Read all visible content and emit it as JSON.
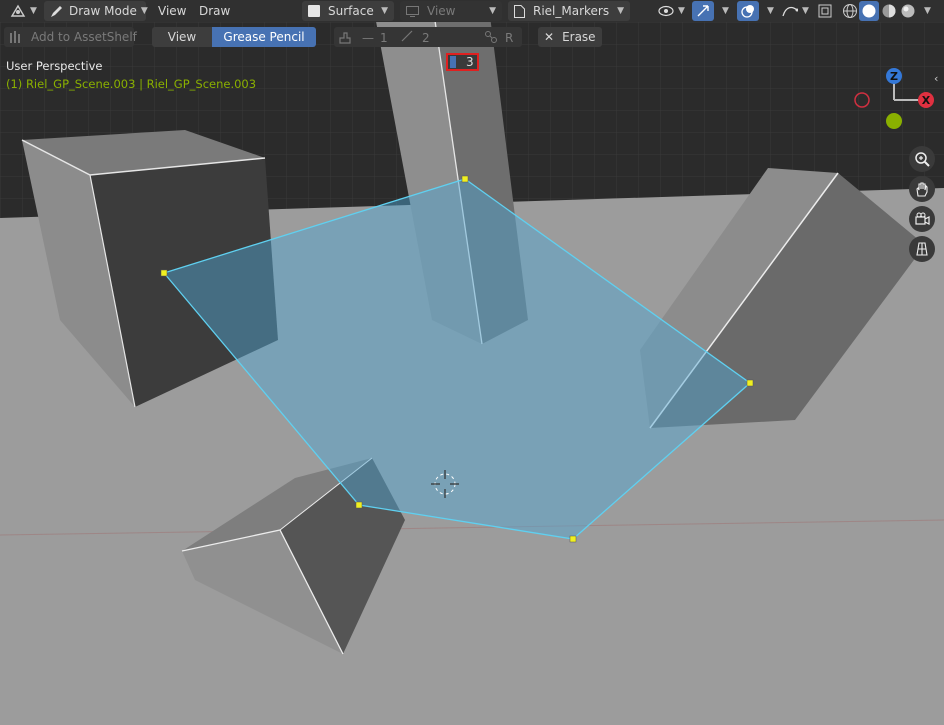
{
  "header": {
    "mode_label": "Draw Mode",
    "menu_view": "View",
    "menu_draw": "Draw",
    "placement_label": "Surface",
    "view_dropdown_label": "View",
    "layer_label": "Riel_Markers"
  },
  "toolbar": {
    "add_asset_label": "Add to AssetShelf",
    "tab_view": "View",
    "tab_grease_pencil": "Grease Pencil",
    "opt1": "1",
    "opt2": "2",
    "opt3": "3",
    "optR": "R",
    "erase_label": "Erase"
  },
  "viewport": {
    "perspective_label": "User Perspective",
    "object_info": "(1) Riel_GP_Scene.003 | Riel_GP_Scene.003"
  },
  "gizmo": {
    "z": "Z",
    "x": "X"
  },
  "colors": {
    "accent": "#4772b3",
    "selection_outline": "#e02020",
    "info_text": "#8ab000",
    "stroke": "#5fd0f0"
  }
}
